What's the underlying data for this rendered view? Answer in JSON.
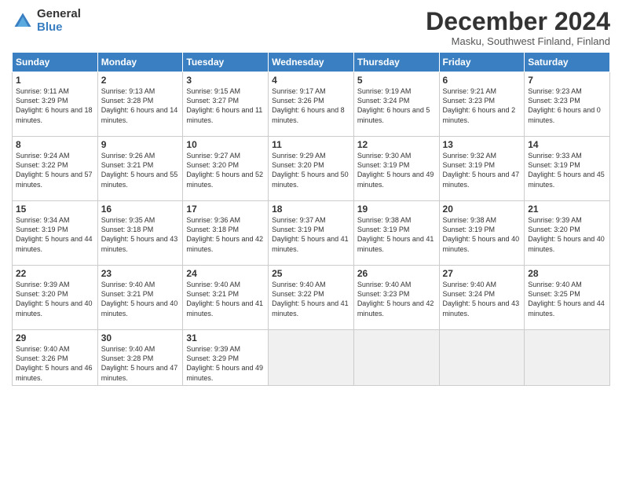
{
  "logo": {
    "general": "General",
    "blue": "Blue"
  },
  "title": "December 2024",
  "location": "Masku, Southwest Finland, Finland",
  "days_of_week": [
    "Sunday",
    "Monday",
    "Tuesday",
    "Wednesday",
    "Thursday",
    "Friday",
    "Saturday"
  ],
  "weeks": [
    [
      {
        "day": 1,
        "sunrise": "9:11 AM",
        "sunset": "3:29 PM",
        "daylight": "6 hours and 18 minutes."
      },
      {
        "day": 2,
        "sunrise": "9:13 AM",
        "sunset": "3:28 PM",
        "daylight": "6 hours and 14 minutes."
      },
      {
        "day": 3,
        "sunrise": "9:15 AM",
        "sunset": "3:27 PM",
        "daylight": "6 hours and 11 minutes."
      },
      {
        "day": 4,
        "sunrise": "9:17 AM",
        "sunset": "3:26 PM",
        "daylight": "6 hours and 8 minutes."
      },
      {
        "day": 5,
        "sunrise": "9:19 AM",
        "sunset": "3:24 PM",
        "daylight": "6 hours and 5 minutes."
      },
      {
        "day": 6,
        "sunrise": "9:21 AM",
        "sunset": "3:23 PM",
        "daylight": "6 hours and 2 minutes."
      },
      {
        "day": 7,
        "sunrise": "9:23 AM",
        "sunset": "3:23 PM",
        "daylight": "6 hours and 0 minutes."
      }
    ],
    [
      {
        "day": 8,
        "sunrise": "9:24 AM",
        "sunset": "3:22 PM",
        "daylight": "5 hours and 57 minutes."
      },
      {
        "day": 9,
        "sunrise": "9:26 AM",
        "sunset": "3:21 PM",
        "daylight": "5 hours and 55 minutes."
      },
      {
        "day": 10,
        "sunrise": "9:27 AM",
        "sunset": "3:20 PM",
        "daylight": "5 hours and 52 minutes."
      },
      {
        "day": 11,
        "sunrise": "9:29 AM",
        "sunset": "3:20 PM",
        "daylight": "5 hours and 50 minutes."
      },
      {
        "day": 12,
        "sunrise": "9:30 AM",
        "sunset": "3:19 PM",
        "daylight": "5 hours and 49 minutes."
      },
      {
        "day": 13,
        "sunrise": "9:32 AM",
        "sunset": "3:19 PM",
        "daylight": "5 hours and 47 minutes."
      },
      {
        "day": 14,
        "sunrise": "9:33 AM",
        "sunset": "3:19 PM",
        "daylight": "5 hours and 45 minutes."
      }
    ],
    [
      {
        "day": 15,
        "sunrise": "9:34 AM",
        "sunset": "3:19 PM",
        "daylight": "5 hours and 44 minutes."
      },
      {
        "day": 16,
        "sunrise": "9:35 AM",
        "sunset": "3:18 PM",
        "daylight": "5 hours and 43 minutes."
      },
      {
        "day": 17,
        "sunrise": "9:36 AM",
        "sunset": "3:18 PM",
        "daylight": "5 hours and 42 minutes."
      },
      {
        "day": 18,
        "sunrise": "9:37 AM",
        "sunset": "3:19 PM",
        "daylight": "5 hours and 41 minutes."
      },
      {
        "day": 19,
        "sunrise": "9:38 AM",
        "sunset": "3:19 PM",
        "daylight": "5 hours and 41 minutes."
      },
      {
        "day": 20,
        "sunrise": "9:38 AM",
        "sunset": "3:19 PM",
        "daylight": "5 hours and 40 minutes."
      },
      {
        "day": 21,
        "sunrise": "9:39 AM",
        "sunset": "3:20 PM",
        "daylight": "5 hours and 40 minutes."
      }
    ],
    [
      {
        "day": 22,
        "sunrise": "9:39 AM",
        "sunset": "3:20 PM",
        "daylight": "5 hours and 40 minutes."
      },
      {
        "day": 23,
        "sunrise": "9:40 AM",
        "sunset": "3:21 PM",
        "daylight": "5 hours and 40 minutes."
      },
      {
        "day": 24,
        "sunrise": "9:40 AM",
        "sunset": "3:21 PM",
        "daylight": "5 hours and 41 minutes."
      },
      {
        "day": 25,
        "sunrise": "9:40 AM",
        "sunset": "3:22 PM",
        "daylight": "5 hours and 41 minutes."
      },
      {
        "day": 26,
        "sunrise": "9:40 AM",
        "sunset": "3:23 PM",
        "daylight": "5 hours and 42 minutes."
      },
      {
        "day": 27,
        "sunrise": "9:40 AM",
        "sunset": "3:24 PM",
        "daylight": "5 hours and 43 minutes."
      },
      {
        "day": 28,
        "sunrise": "9:40 AM",
        "sunset": "3:25 PM",
        "daylight": "5 hours and 44 minutes."
      }
    ],
    [
      {
        "day": 29,
        "sunrise": "9:40 AM",
        "sunset": "3:26 PM",
        "daylight": "5 hours and 46 minutes."
      },
      {
        "day": 30,
        "sunrise": "9:40 AM",
        "sunset": "3:28 PM",
        "daylight": "5 hours and 47 minutes."
      },
      {
        "day": 31,
        "sunrise": "9:39 AM",
        "sunset": "3:29 PM",
        "daylight": "5 hours and 49 minutes."
      },
      null,
      null,
      null,
      null
    ]
  ]
}
